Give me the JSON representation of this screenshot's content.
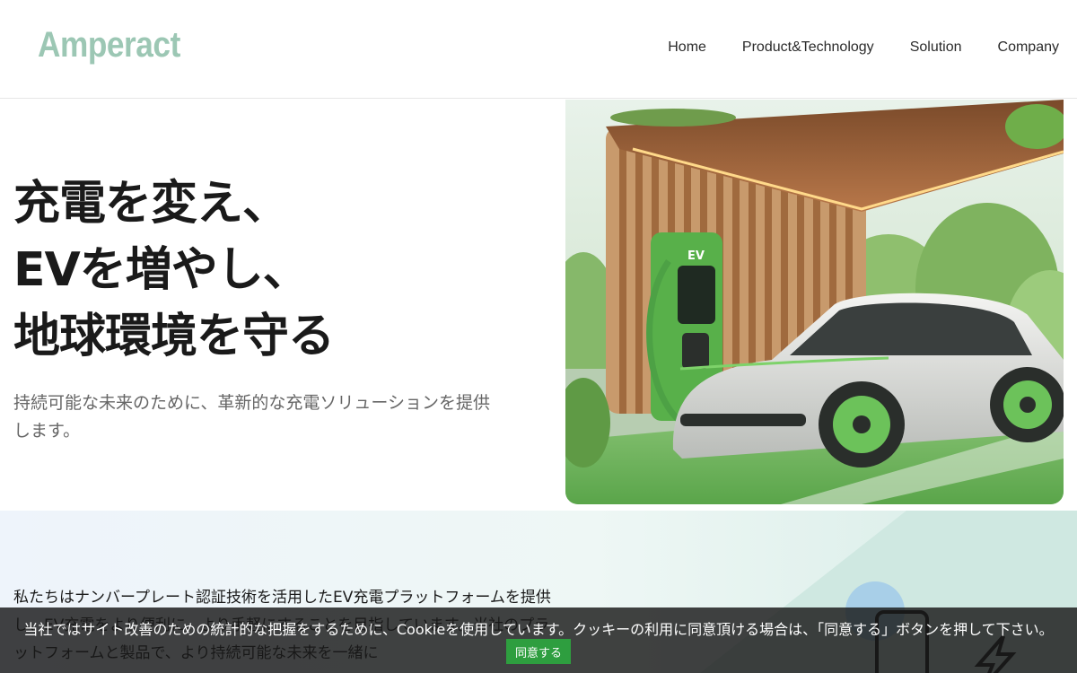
{
  "header": {
    "logo": "Amperact",
    "nav": [
      {
        "label": "Home"
      },
      {
        "label": "Product&Technology"
      },
      {
        "label": "Solution"
      },
      {
        "label": "Company"
      }
    ]
  },
  "hero": {
    "title_lines": [
      "充電を変え、",
      "EVを増やし、",
      "地球環境を守る"
    ],
    "subtitle": "持続可能な未来のために、革新的な充電ソリューションを提供します。",
    "image_alt": "ev-charging-station-illustration",
    "charger_label": "EV"
  },
  "about": {
    "text": "私たちはナンバープレート認証技術を活用したEV充電プラットフォームを提供し、EV充電をより便利に、より手軽にすることを目指しています。当社のプラットフォームと製品で、より持続可能な未来を一緒に"
  },
  "cookie": {
    "text": "当社ではサイト改善のための統計的な把握をするために、Cookieを使用しています。クッキーの利用に同意頂ける場合は、「同意する」ボタンを押して下さい。",
    "button_label": "同意する"
  },
  "colors": {
    "logo": "#9cc7b4",
    "accent_green": "#2e9e3f",
    "banner_bg": "#191919"
  }
}
